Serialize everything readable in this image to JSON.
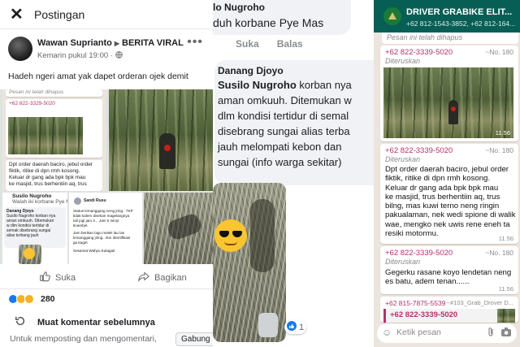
{
  "left": {
    "topbar": {
      "title": "Postingan",
      "close_glyph": "✕"
    },
    "post": {
      "author": "Wawan Suprianto",
      "group": "BERITA VIRAL",
      "meta": "Kemarin pukul 19:00 · ",
      "text": "Hadeh ngeri amat yak dapet orderan ojek demit",
      "reaction_count": "280"
    },
    "mini_screens": {
      "deleted": "Pesan ini telah dihapus",
      "sender": "+62 822-3329-5020",
      "forwarded": "Diteruskan",
      "msg_lines": [
        "Dpt order daerah baciro, jebul order",
        "fiktik, ritike di dpn rmh kosong.",
        "Keluar dr gang ada bpk bpk mau",
        "ke masjid, trus berhentiin aq, trus"
      ],
      "comment_name": "Susilo Nugroho",
      "comment_sub": "Walah iki korbane Pye Mas",
      "card_lines": [
        "Danang Djoyo",
        "Susilo Nugroho korban nya",
        "aman omkuuh. Ditemukan",
        "w dlm kondisi tertidur di",
        "semak disebrang sungai",
        "alias terbang jauh"
      ],
      "story_name": "Sandi Rusu",
      "story_lines": [
        "Status lemanggang neng jring.. TKP",
        "tidak kalem disekan magelangnya",
        "tali jogl jam 3 .. Jam ti minyt",
        "tinambel.",
        "Jam berikan lagu melek lau las",
        "lemanggang jiring.. Ikm identifikasi",
        "ga kaget",
        "Sesamat Wahyu Kalagati"
      ]
    },
    "actions": {
      "like": "Suka",
      "share": "Bagikan"
    },
    "more_comments": "Muat komentar sebelumnya",
    "comment_prompt": "Untuk memposting dan mengomentari,",
    "join_button": "Gabung"
  },
  "mid": {
    "comment1": {
      "name": "lo Nugroho",
      "text": "duh korbane Pye Mas"
    },
    "actions": [
      "Suka",
      "Balas"
    ],
    "comment2": {
      "name": "Danang Djoyo",
      "tag": "Susilo Nugroho",
      "lines": [
        " korban nya",
        "aman omkuuh. Ditemukan w",
        "dlm kondisi tertidur di semal",
        "disebrang sungai alias terba",
        "jauh melompati kebon dan",
        "sungai (info warga sekitar)"
      ]
    },
    "like_count": "1"
  },
  "right": {
    "header": {
      "title": "DRIVER GRABIKE ELIT...",
      "members": "+62 812-1543-3852, +62 812-164..."
    },
    "deleted": "Pesan ini telah dihapus",
    "messages": [
      {
        "sender": "+62 822-3339-5020",
        "fwd": "Diteruskan",
        "num": "~No. 180",
        "time": "11.56"
      },
      {
        "sender": "+62 822-3339-5020",
        "fwd": "Diteruskan",
        "num": "~No. 180",
        "lines": [
          "Dpt order daerah baciro, jebul order",
          "fiktik, ritike di dpn rmh kosong.",
          "Keluar dr gang ada bpk bpk mau",
          "ke masjid, trus berhentiin aq, trus",
          "bilng, mas kuwi terno neng ringin",
          "pakualaman, nek wedi spione di walik",
          "wae, mengko nek uwis rene eneh ta",
          "resiki motormu."
        ],
        "time": "11.56"
      },
      {
        "sender": "+62 822-3339-5020",
        "fwd": "Diteruskan",
        "num": "~No. 180",
        "lines": [
          "Gegerku rasane koyo lendetan neng",
          "es batu, adem tenan......"
        ],
        "time": "11.56"
      },
      {
        "sender": "+62 815-7875-5539",
        "num": "~#103_Grab_Drover D...",
        "quote": "+62 822-3339-5020"
      }
    ],
    "input_placeholder": "Ketik pesan"
  }
}
